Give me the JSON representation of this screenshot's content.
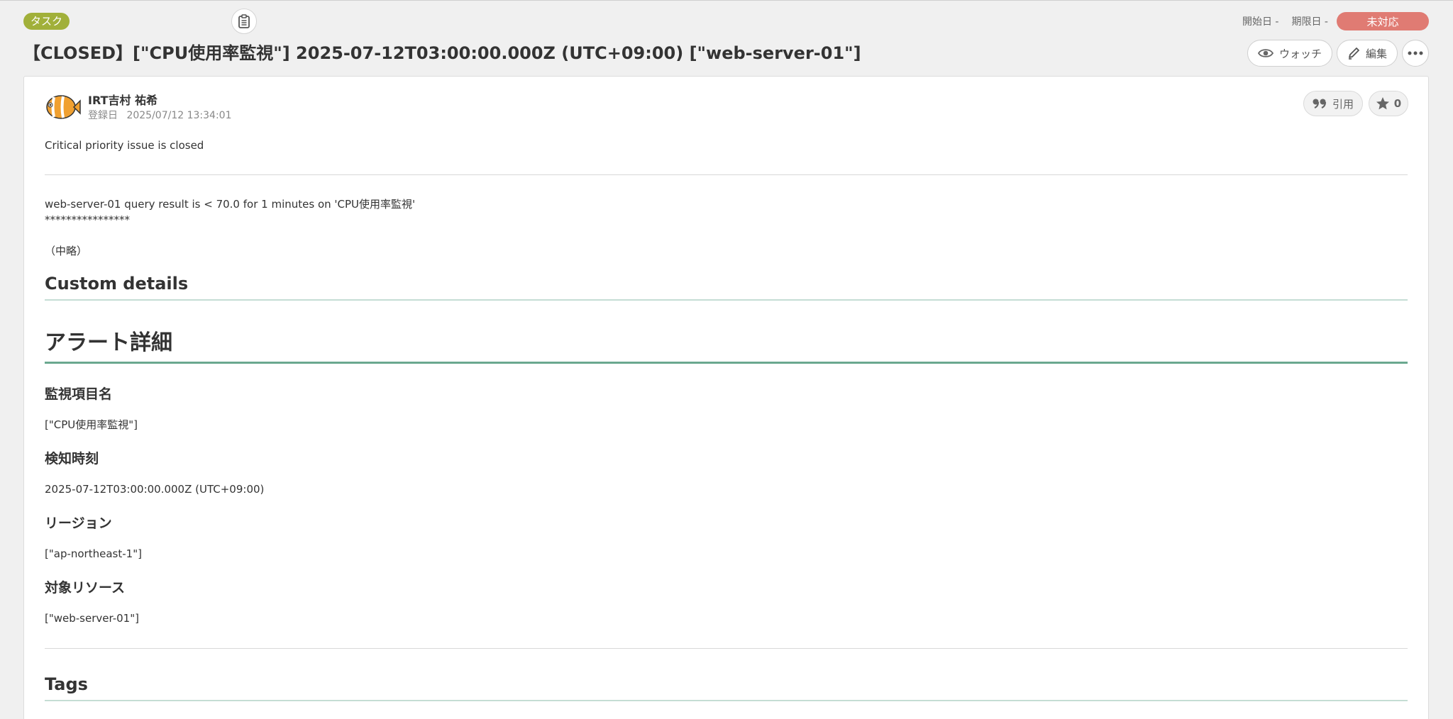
{
  "header": {
    "type_label": "タスク",
    "start_label": "開始日 -",
    "due_label": "期限日 -",
    "status_label": "未対応",
    "title": "【CLOSED】[\"CPU使用率監視\"] 2025-07-12T03:00:00.000Z (UTC+09:00) [\"web-server-01\"]",
    "watch_label": "ウォッチ",
    "edit_label": "編集"
  },
  "comment": {
    "author": "IRT吉村 祐希",
    "registered_label": "登録日",
    "registered_at": "2025/07/12 13:34:01",
    "quote_label": "引用",
    "star_count": "0"
  },
  "content": {
    "summary": "Critical priority issue is closed",
    "query_line": "web-server-01 query result is < 70.0 for 1 minutes on 'CPU使用率監視'",
    "asterisks": "****************",
    "omitted": "（中略）",
    "custom_details_heading": "Custom details",
    "alert_heading": "アラート詳細",
    "fields": [
      {
        "label": "監視項目名",
        "value": "[\"CPU使用率監視\"]"
      },
      {
        "label": "検知時刻",
        "value": "2025-07-12T03:00:00.000Z (UTC+09:00)"
      },
      {
        "label": "リージョン",
        "value": "[\"ap-northeast-1\"]"
      },
      {
        "label": "対象リソース",
        "value": "[\"web-server-01\"]"
      }
    ],
    "tags_heading": "Tags"
  },
  "colors": {
    "type_badge": "#a1b03a",
    "status_badge": "#e07b73",
    "heading_underline": "#6aa88f"
  },
  "icons": {
    "clipboard": "clipboard-icon",
    "watch": "eye-icon",
    "edit": "pencil-icon",
    "more": "more-horizontal-icon",
    "quote": "quote-icon",
    "star": "star-icon",
    "avatar": "clownfish-avatar"
  }
}
